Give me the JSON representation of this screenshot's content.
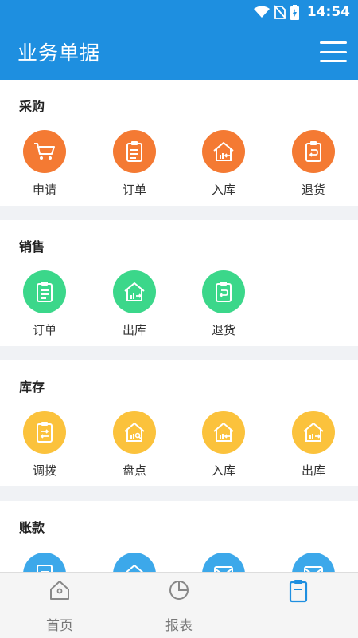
{
  "status_bar": {
    "time": "14:54",
    "icons": [
      "wifi-icon",
      "no-sim-icon",
      "battery-charging-icon"
    ]
  },
  "app_bar": {
    "title": "业务单据",
    "menu_icon": "menu-icon"
  },
  "colors": {
    "primary": "#1e8fe0",
    "orange": "#f47a33",
    "green": "#3bd78a",
    "yellow": "#fbc23c",
    "blue": "#3ca8ea"
  },
  "sections": {
    "purchase": {
      "title": "采购",
      "items": [
        {
          "label": "申请",
          "icon": "cart-icon"
        },
        {
          "label": "订单",
          "icon": "clipboard-icon"
        },
        {
          "label": "入库",
          "icon": "warehouse-in-icon"
        },
        {
          "label": "退货",
          "icon": "return-icon"
        }
      ]
    },
    "sales": {
      "title": "销售",
      "items": [
        {
          "label": "订单",
          "icon": "clipboard-icon"
        },
        {
          "label": "出库",
          "icon": "warehouse-out-icon"
        },
        {
          "label": "退货",
          "icon": "return-icon"
        }
      ]
    },
    "inventory": {
      "title": "库存",
      "items": [
        {
          "label": "调拨",
          "icon": "transfer-icon"
        },
        {
          "label": "盘点",
          "icon": "stocktake-icon"
        },
        {
          "label": "入库",
          "icon": "warehouse-in-icon"
        },
        {
          "label": "出库",
          "icon": "warehouse-out-icon"
        }
      ]
    },
    "accounts": {
      "title": "账款",
      "items": [
        {
          "icon": "document-icon"
        },
        {
          "icon": "house-icon"
        },
        {
          "icon": "mail-icon"
        },
        {
          "icon": "mail-icon"
        }
      ]
    }
  },
  "bottom_nav": {
    "items": [
      {
        "label": "首页",
        "icon": "home-icon"
      },
      {
        "label": "报表",
        "icon": "pie-chart-icon"
      },
      {
        "label": "",
        "icon": "document-list-icon",
        "active": true
      }
    ]
  }
}
